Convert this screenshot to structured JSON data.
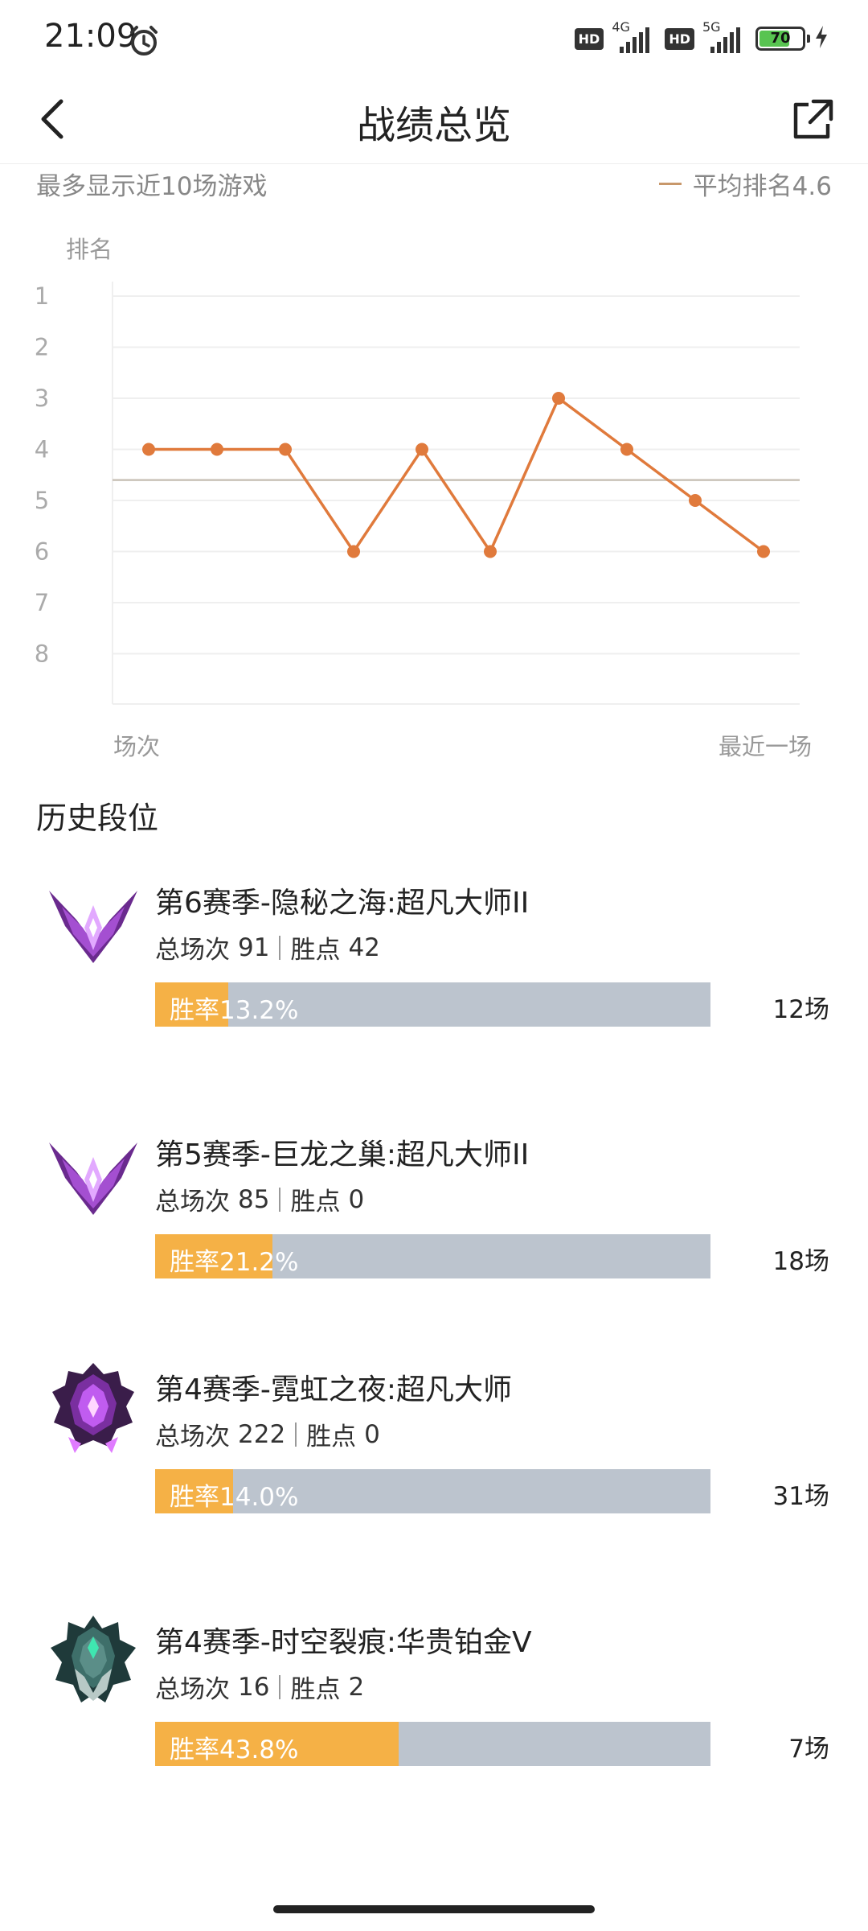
{
  "status_bar": {
    "time": "21:09",
    "sim1_network": "4G",
    "sim2_network": "5G",
    "hd1": "HD",
    "hd2": "HD",
    "battery_level": "70",
    "icons": [
      "alarm-icon",
      "signal-icon",
      "battery-icon",
      "charging-icon"
    ]
  },
  "header": {
    "title": "战绩总览",
    "back_icon": "chevron-left-icon",
    "share_icon": "share-external-icon"
  },
  "chart_section": {
    "note": "最多显示近10场游戏",
    "avg_label": "平均排名4.6"
  },
  "chart_data": {
    "type": "line",
    "ylabel": "排名",
    "x_start_label": "场次",
    "x_end_label": "最近一场",
    "y_ticks": [
      "1",
      "2",
      "3",
      "4",
      "5",
      "6",
      "7",
      "8"
    ],
    "ylim": [
      1,
      8
    ],
    "y_inverted": true,
    "grid": true,
    "series": [
      {
        "values": [
          4,
          4,
          4,
          6,
          4,
          6,
          3,
          4,
          5,
          6
        ],
        "color": "#e07a3c"
      }
    ],
    "average": 4.6,
    "average_color": "#c9c2b8"
  },
  "history": {
    "title": "历史段位",
    "seasons": [
      {
        "title": "第6赛季-隐秘之海:超凡大师II",
        "total_label": "总场次",
        "total": "91",
        "points_label": "胜点",
        "points": "42",
        "winrate_label": "胜率13.2%",
        "winrate": 0.132,
        "games": "12场",
        "emblem": "master-wings-emblem-icon",
        "emblem_color": "#8a3fb0"
      },
      {
        "title": "第5赛季-巨龙之巢:超凡大师II",
        "total_label": "总场次",
        "total": "85",
        "points_label": "胜点",
        "points": "0",
        "winrate_label": "胜率21.2%",
        "winrate": 0.212,
        "games": "18场",
        "emblem": "master-wings-emblem-icon",
        "emblem_color": "#8a3fb0"
      },
      {
        "title": "第4赛季-霓虹之夜:超凡大师",
        "total_label": "总场次",
        "total": "222",
        "points_label": "胜点",
        "points": "0",
        "winrate_label": "胜率14.0%",
        "winrate": 0.14,
        "games": "31场",
        "emblem": "master-crest-emblem-icon",
        "emblem_color": "#9b3cc4"
      },
      {
        "title": "第4赛季-时空裂痕:华贵铂金V",
        "total_label": "总场次",
        "total": "16",
        "points_label": "胜点",
        "points": "2",
        "winrate_label": "胜率43.8%",
        "winrate": 0.438,
        "games": "7场",
        "emblem": "platinum-crest-emblem-icon",
        "emblem_color": "#3fd6a8"
      }
    ]
  }
}
